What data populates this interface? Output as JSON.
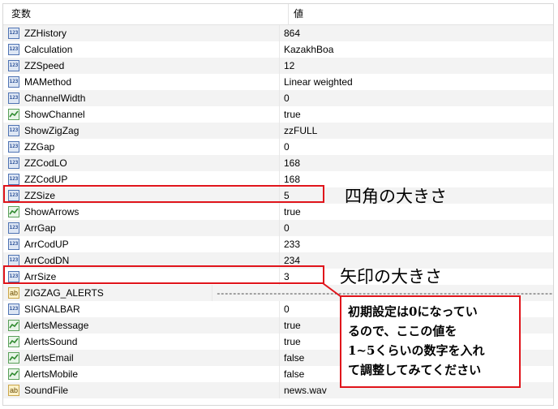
{
  "header": {
    "col_variable": "変数",
    "col_value": "値"
  },
  "rows": [
    {
      "type": "num",
      "name": "ZZHistory",
      "value": "864"
    },
    {
      "type": "num",
      "name": "Calculation",
      "value": "KazakhBoa"
    },
    {
      "type": "num",
      "name": "ZZSpeed",
      "value": "12"
    },
    {
      "type": "num",
      "name": "MAMethod",
      "value": "Linear weighted"
    },
    {
      "type": "num",
      "name": "ChannelWidth",
      "value": "0"
    },
    {
      "type": "bool",
      "name": "ShowChannel",
      "value": "true"
    },
    {
      "type": "num",
      "name": "ShowZigZag",
      "value": "zzFULL"
    },
    {
      "type": "num",
      "name": "ZZGap",
      "value": "0"
    },
    {
      "type": "num",
      "name": "ZZCodLO",
      "value": "168"
    },
    {
      "type": "num",
      "name": "ZZCodUP",
      "value": "168"
    },
    {
      "type": "num",
      "name": "ZZSize",
      "value": "5"
    },
    {
      "type": "bool",
      "name": "ShowArrows",
      "value": "true"
    },
    {
      "type": "num",
      "name": "ArrGap",
      "value": "0"
    },
    {
      "type": "num",
      "name": "ArrCodUP",
      "value": "233"
    },
    {
      "type": "num",
      "name": "ArrCodDN",
      "value": "234"
    },
    {
      "type": "num",
      "name": "ArrSize",
      "value": "3"
    },
    {
      "type": "str",
      "name": "ZIGZAG_ALERTS",
      "value": "-----------------------------------------------------------------------------------"
    },
    {
      "type": "num",
      "name": "SIGNALBAR",
      "value": "0"
    },
    {
      "type": "bool",
      "name": "AlertsMessage",
      "value": "true"
    },
    {
      "type": "bool",
      "name": "AlertsSound",
      "value": "true"
    },
    {
      "type": "bool",
      "name": "AlertsEmail",
      "value": "false"
    },
    {
      "type": "bool",
      "name": "AlertsMobile",
      "value": "false"
    },
    {
      "type": "str",
      "name": "SoundFile",
      "value": "news.wav"
    }
  ],
  "icons": {
    "num": "123",
    "str": "ab"
  },
  "annotations": {
    "zzsize_note": "四角の大きさ",
    "arrsize_note": "矢印の大きさ",
    "callout_lines": [
      "初期設定は0になってい",
      "るので、ここの値を",
      "1~5くらいの数字を入れ",
      "て調整してみてください"
    ]
  },
  "colors": {
    "highlight": "#e0141b",
    "row_alt": "#f3f3f3",
    "grid_border": "#d7d7d7"
  }
}
